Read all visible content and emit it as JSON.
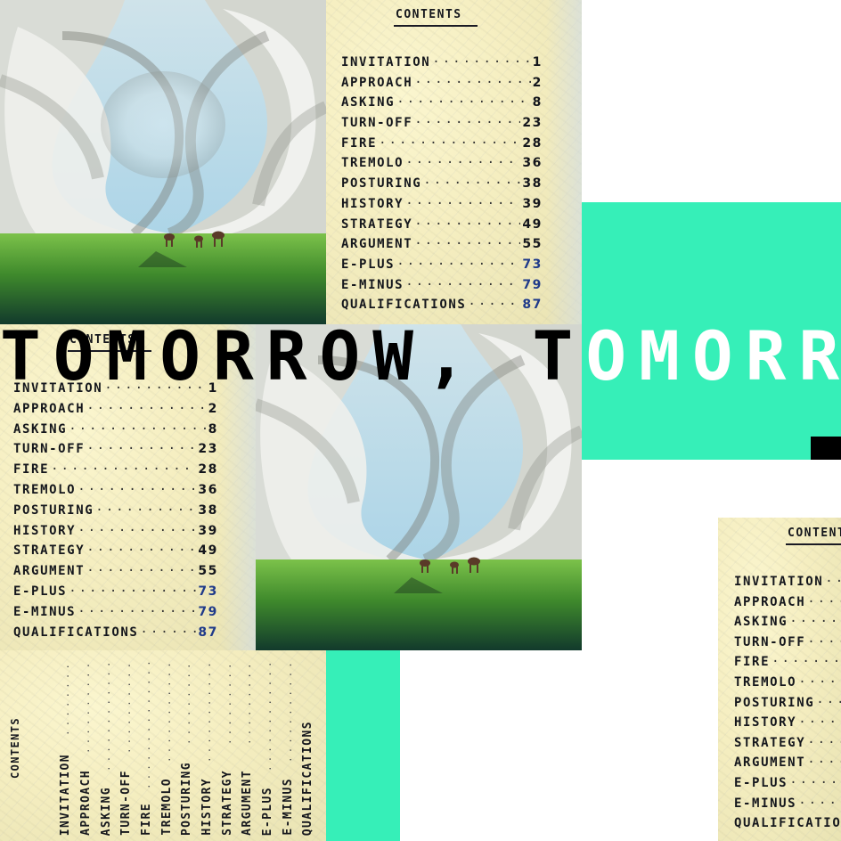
{
  "headline": {
    "part_black": "TOMORROW, T",
    "part_white": "OMORR"
  },
  "contents": {
    "title": "CONTENTS",
    "entries": [
      {
        "label": "INVITATION",
        "page": "1"
      },
      {
        "label": "APPROACH",
        "page": "2"
      },
      {
        "label": "ASKING",
        "page": "8"
      },
      {
        "label": "TURN-OFF",
        "page": "23"
      },
      {
        "label": "FIRE",
        "page": "28"
      },
      {
        "label": "TREMOLO",
        "page": "36"
      },
      {
        "label": "POSTURING",
        "page": "38"
      },
      {
        "label": "HISTORY",
        "page": "39"
      },
      {
        "label": "STRATEGY",
        "page": "49"
      },
      {
        "label": "ARGUMENT",
        "page": "55"
      },
      {
        "label": "E-PLUS",
        "page": "73"
      },
      {
        "label": "E-MINUS",
        "page": "79"
      },
      {
        "label": "QUALIFICATIONS",
        "page": "87"
      }
    ]
  },
  "colors": {
    "accent": "#36efb8",
    "ink": "#14161c",
    "paper": "#f5eec0"
  }
}
